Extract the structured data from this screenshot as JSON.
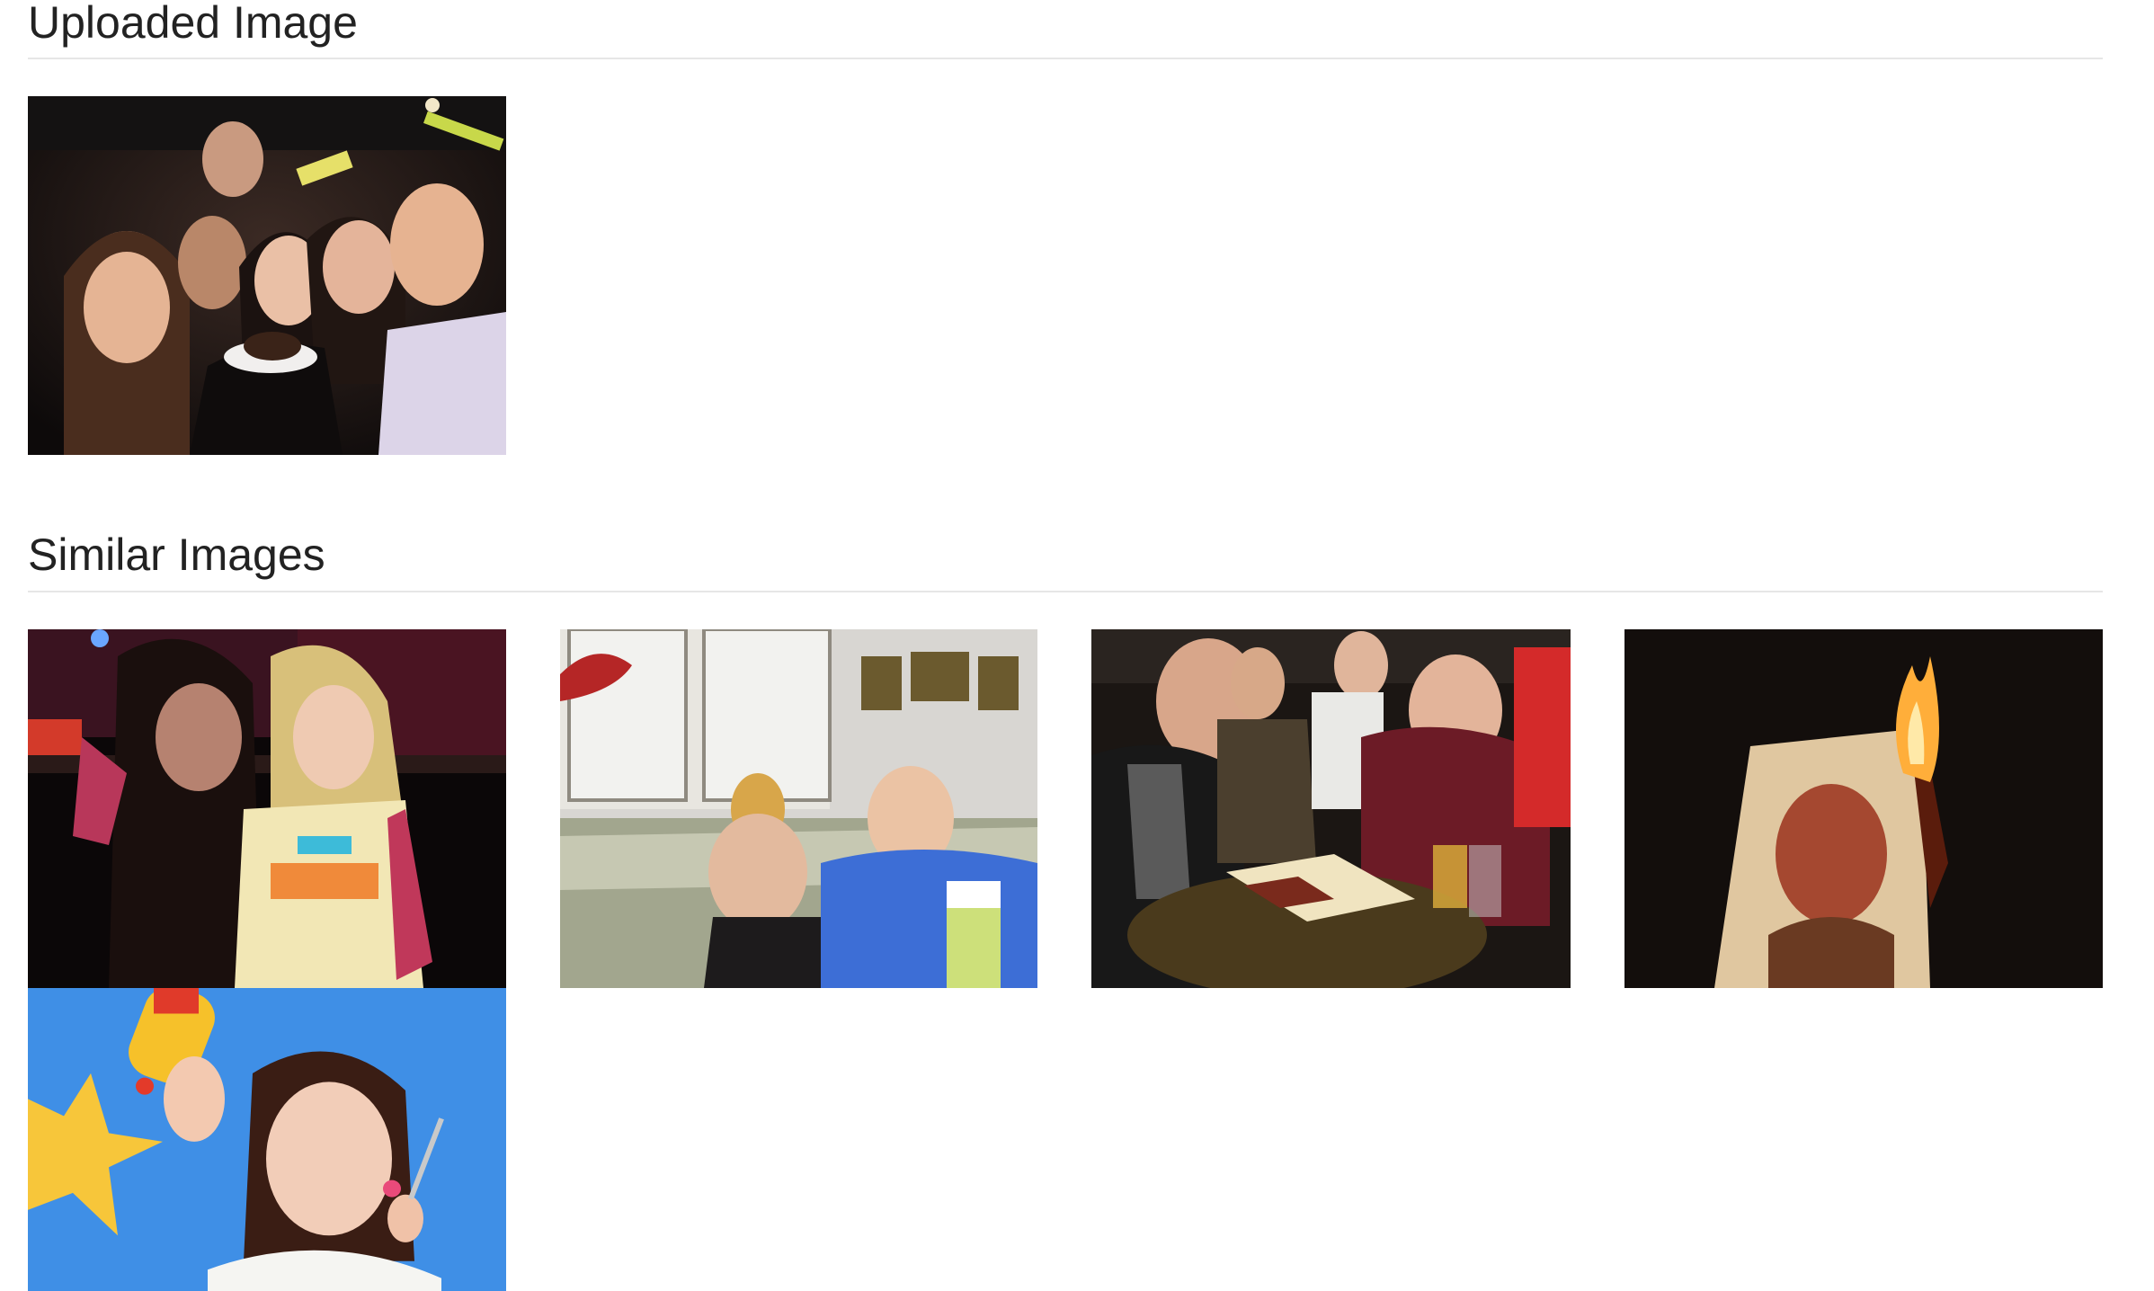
{
  "uploaded_section": {
    "title": "Uploaded Image",
    "image": {
      "subject": "group-party-photo"
    }
  },
  "similar_section": {
    "title": "Similar Images",
    "images": [
      {
        "subject": "two-women-at-bar"
      },
      {
        "subject": "couple-on-couch"
      },
      {
        "subject": "chess-game-group"
      },
      {
        "subject": "burning-photo"
      },
      {
        "subject": "woman-with-mustard"
      }
    ]
  },
  "colors": {
    "heading": "#222222",
    "divider": "#e6e6e6",
    "background": "#ffffff"
  }
}
